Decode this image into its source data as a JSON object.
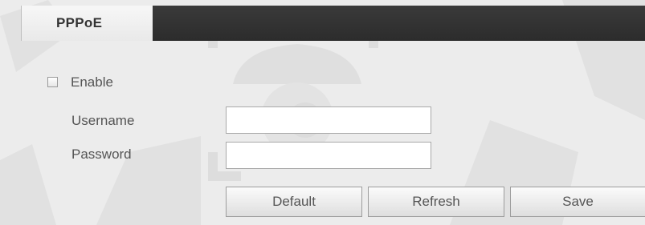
{
  "tabs": [
    {
      "label": "PPPoE",
      "active": true
    }
  ],
  "form": {
    "enable": {
      "label": "Enable",
      "checked": false
    },
    "username": {
      "label": "Username",
      "value": ""
    },
    "password": {
      "label": "Password",
      "value": ""
    }
  },
  "buttons": {
    "default_label": "Default",
    "refresh_label": "Refresh",
    "save_label": "Save"
  },
  "colors": {
    "tab_bar": "#2f2f2f",
    "background": "#ececec",
    "text": "#555555"
  }
}
